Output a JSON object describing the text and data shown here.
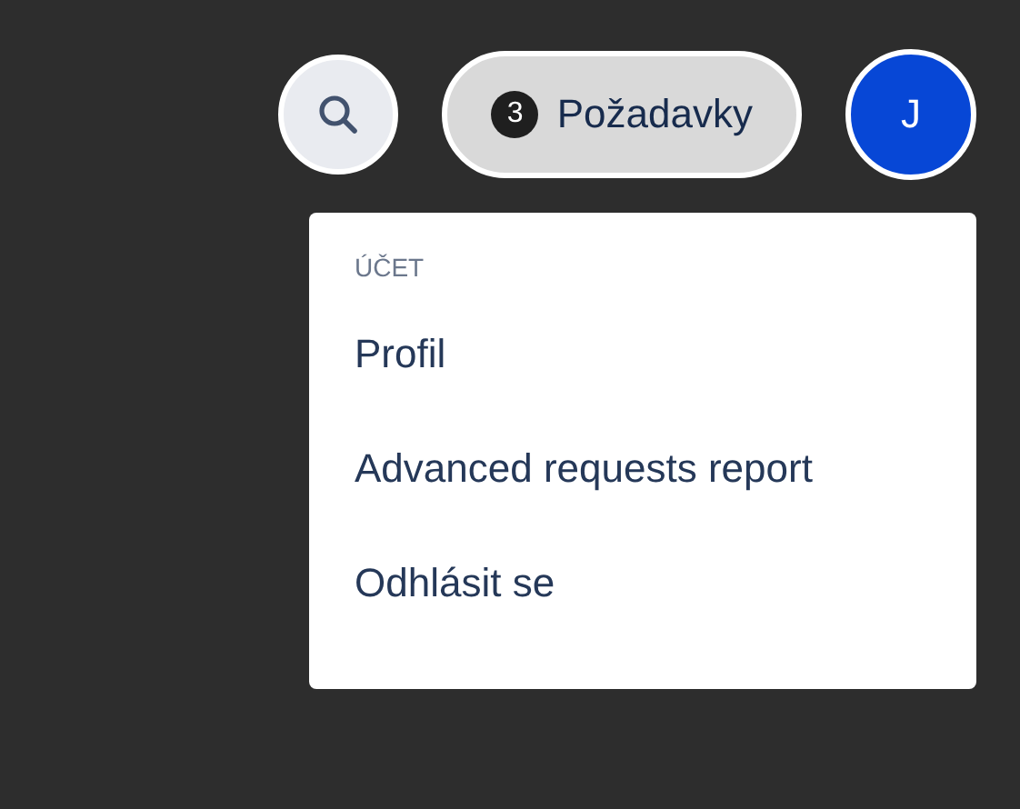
{
  "header": {
    "requests_button": {
      "count": "3",
      "label": "Požadavky"
    },
    "avatar": {
      "initial": "J"
    }
  },
  "menu": {
    "heading": "ÚČET",
    "items": [
      {
        "label": "Profil"
      },
      {
        "label": "Advanced requests report"
      },
      {
        "label": "Odhlásit se"
      }
    ]
  }
}
